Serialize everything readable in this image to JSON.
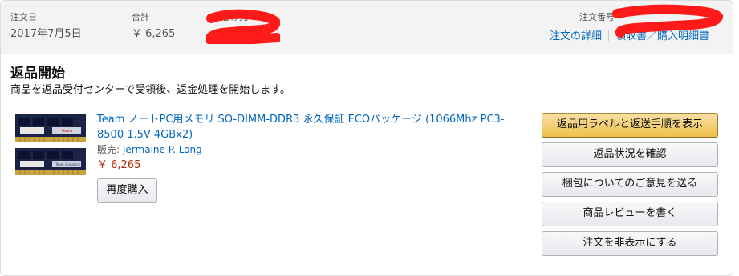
{
  "order_header": {
    "order_date_label": "注文日",
    "order_date": "2017年7月5日",
    "total_label": "合計",
    "total": "￥ 6,265",
    "ship_to_label": "お届け先",
    "order_number_label": "注文番号",
    "details_link": "注文の詳細",
    "invoice_link": "領収書／購入明細書"
  },
  "status": {
    "title": "返品開始",
    "description": "商品を返品受付センターで受領後、返金処理を開始します。"
  },
  "item": {
    "title": "Team ノートPC用メモリ SO-DIMM-DDR3 永久保証 ECOパッケージ (1066Mhz PC3-8500 1.5V 4GBx2)",
    "seller_label": "販売:",
    "seller_name": "Jermaine P. Long",
    "price": "￥ 6,265",
    "buy_again_label": "再度購入",
    "image_text": "team",
    "image_chip_text": "Team Group Inc."
  },
  "actions": [
    {
      "label": "返品用ラベルと返送手順を表示",
      "primary": true
    },
    {
      "label": "返品状況を確認",
      "primary": false
    },
    {
      "label": "梱包についてのご意見を送る",
      "primary": false
    },
    {
      "label": "商品レビューを書く",
      "primary": false
    },
    {
      "label": "注文を非表示にする",
      "primary": false
    }
  ],
  "colors": {
    "link": "#0066c0",
    "price": "#b12704",
    "primary_button": "#f0c14b",
    "header_bg": "#f3f3f3",
    "redaction": "#ff1a1a"
  }
}
